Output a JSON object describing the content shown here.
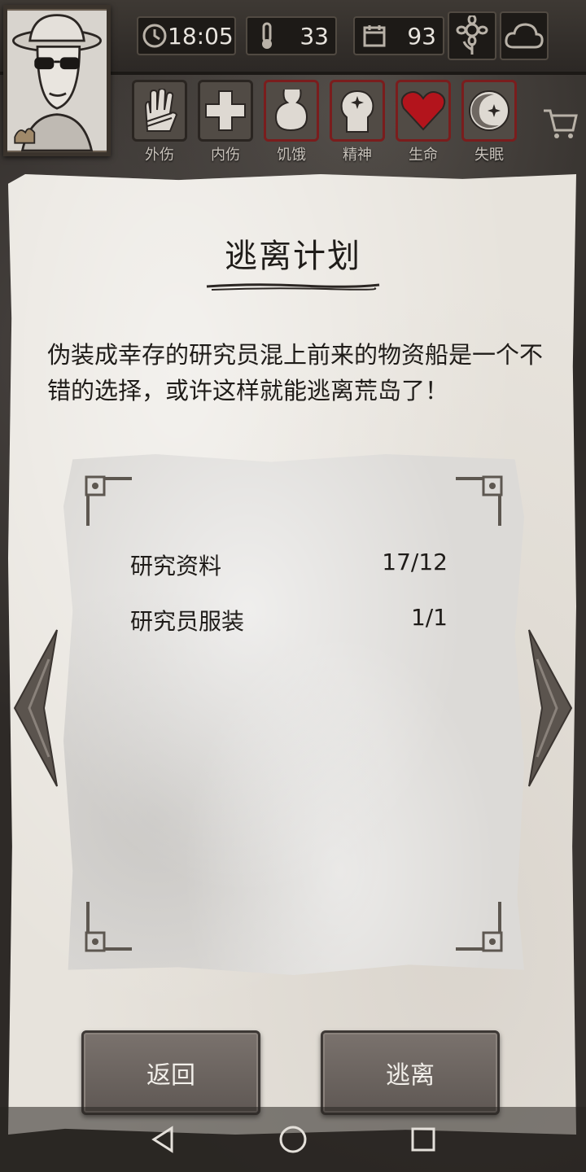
{
  "hud": {
    "time": "18:05",
    "temperature": "33",
    "days": "93"
  },
  "status_icons": [
    {
      "label": "外伤",
      "icon": "bandaged-hand-icon",
      "warn": false
    },
    {
      "label": "内伤",
      "icon": "cross-icon",
      "warn": false
    },
    {
      "label": "饥饿",
      "icon": "stomach-icon",
      "warn": true
    },
    {
      "label": "精神",
      "icon": "head-sparkle-icon",
      "warn": true
    },
    {
      "label": "生命",
      "icon": "heart-icon",
      "warn": true
    },
    {
      "label": "失眠",
      "icon": "moon-icon",
      "warn": true
    }
  ],
  "panel": {
    "title": "逃离计划",
    "description": "伪装成幸存的研究员混上前来的物资船是一个不错的选择，或许这样就能逃离荒岛了！",
    "requirements": [
      {
        "name": "研究资料",
        "count": "17/12"
      },
      {
        "name": "研究员服装",
        "count": "1/1"
      }
    ]
  },
  "buttons": {
    "back": "返回",
    "escape": "逃离"
  },
  "colors": {
    "paper": "#e7e3dc",
    "button": "#6e6662",
    "warn_border": "#7a1d1d",
    "heart": "#b3141c"
  }
}
